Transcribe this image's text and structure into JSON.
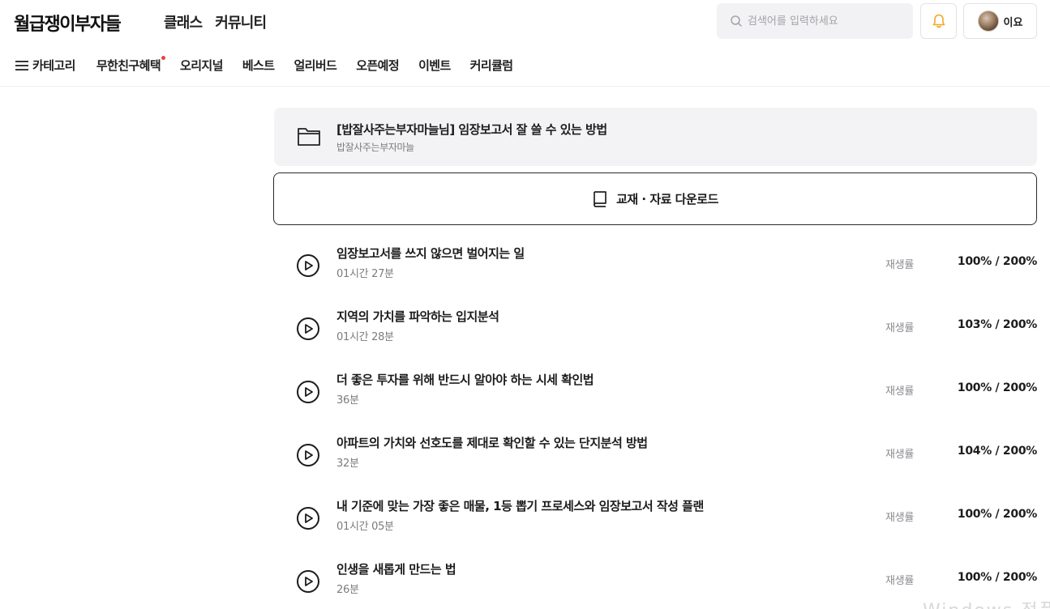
{
  "header": {
    "logo": "월급쟁이부자들",
    "nav": [
      "클래스",
      "커뮤니티"
    ],
    "search_placeholder": "검색어를 입력하세요",
    "user_name": "이요"
  },
  "subnav": {
    "category_label": "카테고리",
    "items": [
      "무한친구혜택",
      "오리지널",
      "베스트",
      "얼리버드",
      "오픈예정",
      "이벤트",
      "커리큘럼"
    ]
  },
  "folder": {
    "title": "[밥잘사주는부자마늘님] 임장보고서 잘 쓸 수 있는 방법",
    "subtitle": "밥잘사주는부자마늘"
  },
  "download": {
    "label": "교재 · 자료 다운로드"
  },
  "lessons": [
    {
      "title": "임장보고서를 쓰지 않으면 벌어지는 일",
      "duration": "01시간 27분",
      "rate_label": "재생률",
      "rate": "100% / 200%"
    },
    {
      "title": "지역의 가치를 파악하는 입지분석",
      "duration": "01시간 28분",
      "rate_label": "재생률",
      "rate": "103% / 200%"
    },
    {
      "title": "더 좋은 투자를 위해 반드시 알아야 하는 시세 확인법",
      "duration": "36분",
      "rate_label": "재생률",
      "rate": "100% / 200%"
    },
    {
      "title": "아파트의 가치와 선호도를 제대로 확인할 수 있는 단지분석 방법",
      "duration": "32분",
      "rate_label": "재생률",
      "rate": "104% / 200%"
    },
    {
      "title": "내 기준에 맞는 가장 좋은 매물, 1등 뽑기 프로세스와 임장보고서 작성 플랜",
      "duration": "01시간 05분",
      "rate_label": "재생률",
      "rate": "100% / 200%"
    },
    {
      "title": "인생을 새롭게 만드는 법",
      "duration": "26분",
      "rate_label": "재생률",
      "rate": "100% / 200%"
    }
  ],
  "watermark": "Windows 정품",
  "colors": {
    "accent_bell": "#f5a623",
    "new_dot": "#e8443a",
    "card_bg": "#f3f3f5"
  }
}
